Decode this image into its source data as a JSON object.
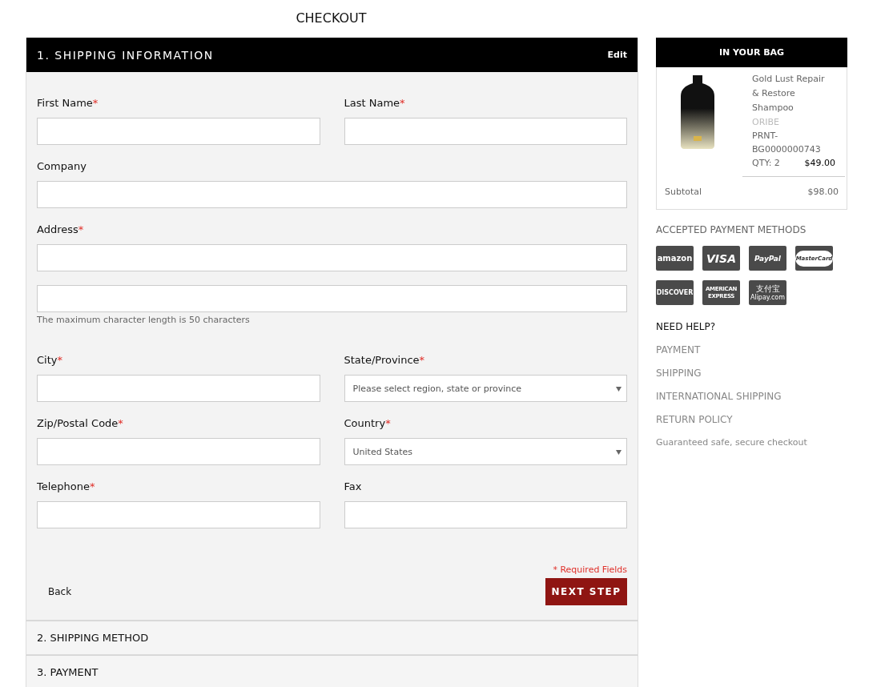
{
  "page_title": "CHECKOUT",
  "shipping_section": {
    "title": "1. SHIPPING INFORMATION",
    "edit_link": "Edit",
    "rows": [
      {
        "fields": [
          {
            "label": "First Name",
            "required": true,
            "kind": "text"
          },
          {
            "label": "Last Name",
            "required": true,
            "kind": "text"
          }
        ]
      },
      {
        "fields": [
          {
            "label": "Company",
            "required": false,
            "kind": "text"
          }
        ]
      },
      {
        "fields": [
          {
            "label": "Address",
            "required": true,
            "kind": "text"
          }
        ]
      },
      {
        "fields": [
          {
            "kind": "text",
            "note": "The maximum character length is 50 characters"
          }
        ]
      },
      {
        "fields": [
          {
            "label": "City",
            "required": true,
            "kind": "text"
          },
          {
            "label": "State/Province",
            "required": true,
            "kind": "select",
            "value": "Please select region, state or province"
          }
        ]
      },
      {
        "fields": [
          {
            "label": "Zip/Postal Code",
            "required": true,
            "kind": "text"
          },
          {
            "label": "Country",
            "required": true,
            "kind": "select",
            "value": "United States"
          }
        ]
      },
      {
        "fields": [
          {
            "label": "Telephone",
            "required": true,
            "kind": "text"
          },
          {
            "label": "Fax",
            "required": false,
            "kind": "text"
          }
        ]
      }
    ],
    "required_mark": "*",
    "required_note": "* Required Fields",
    "back_link": "Back",
    "next_button": "NEXT STEP"
  },
  "collapsed_sections": [
    {
      "title": "2. SHIPPING METHOD"
    },
    {
      "title": "3. PAYMENT"
    }
  ],
  "bag": {
    "title": "IN YOUR BAG",
    "items": [
      {
        "name": "Gold Lust Repair & Restore Shampoo",
        "brand": "ORIBE",
        "sku": "PRNT-BG0000000743",
        "qty": "QTY: 2",
        "price": "$49.00"
      }
    ],
    "subtotal_label": "Subtotal",
    "subtotal": "$98.00"
  },
  "payment_methods": {
    "title": "ACCEPTED PAYMENT METHODS",
    "logos": [
      {
        "kind": "amazon",
        "lines": [
          "amazon"
        ]
      },
      {
        "kind": "visa",
        "lines": [
          "VISA"
        ]
      },
      {
        "kind": "paypal",
        "lines": [
          "PayPal"
        ]
      },
      {
        "kind": "mastercard",
        "lines": [
          "MasterCard"
        ]
      },
      {
        "kind": "discover",
        "lines": [
          "DISCOVER"
        ]
      },
      {
        "kind": "amex",
        "lines": [
          "AMERICAN",
          "EXPRESS"
        ]
      },
      {
        "kind": "alipay",
        "lines": [
          "支付宝",
          "Alipay.com"
        ]
      }
    ]
  },
  "help": {
    "title": "NEED HELP?",
    "links": [
      "PAYMENT",
      "SHIPPING",
      "INTERNATIONAL SHIPPING",
      "RETURN POLICY"
    ],
    "note": "Guaranteed safe, secure checkout"
  }
}
